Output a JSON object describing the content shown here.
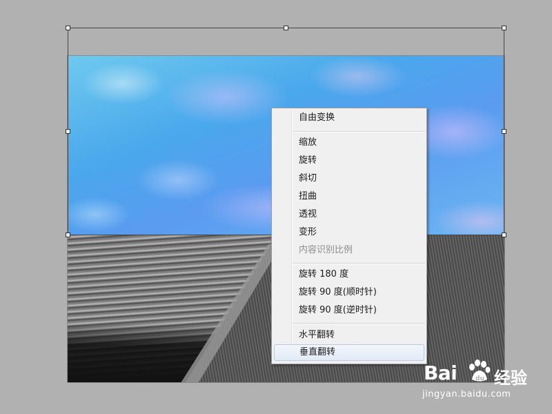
{
  "context_menu": {
    "items": [
      {
        "label": "自由变换",
        "enabled": true
      },
      {
        "label": "缩放",
        "enabled": true
      },
      {
        "label": "旋转",
        "enabled": true
      },
      {
        "label": "斜切",
        "enabled": true
      },
      {
        "label": "扭曲",
        "enabled": true
      },
      {
        "label": "透视",
        "enabled": true
      },
      {
        "label": "变形",
        "enabled": true
      },
      {
        "label": "内容识别比例",
        "enabled": false
      },
      {
        "label": "旋转 180 度",
        "enabled": true
      },
      {
        "label": "旋转 90 度(顺时针)",
        "enabled": true
      },
      {
        "label": "旋转 90 度(逆时针)",
        "enabled": true
      },
      {
        "label": "水平翻转",
        "enabled": true
      },
      {
        "label": "垂直翻转",
        "enabled": true,
        "highlighted": true
      }
    ]
  },
  "watermark": {
    "brand": "Bai",
    "brand_cn": "经验",
    "url": "jingyan.baidu.com"
  },
  "colors": {
    "workspace_bg": "#b1b1b1",
    "menu_bg": "#f0f0f0",
    "menu_highlight": "#e3ebf7",
    "disabled_text": "#8d8d8d"
  }
}
